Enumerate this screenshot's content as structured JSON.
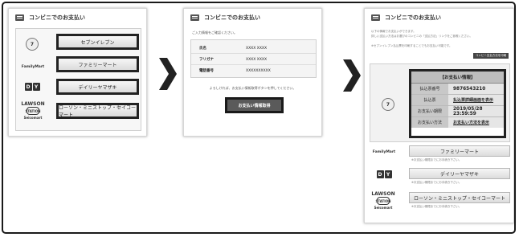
{
  "panel1": {
    "title": "コンビニでのお支払い",
    "stores": [
      {
        "logo": "7",
        "label": "セブンイレブン"
      },
      {
        "logo": "FamilyMart",
        "label": "ファミリーマート"
      },
      {
        "logo": "DY",
        "label": "デイリーヤマザキ"
      },
      {
        "logo": "LAWSON",
        "label": "ローソン・ミニストップ・セイコーマート"
      }
    ]
  },
  "panel2": {
    "title": "コンビニでのお支払い",
    "intro": "ご入力情報をご確認ください。",
    "rows": [
      {
        "key": "氏名",
        "value": "XXXX XXXX"
      },
      {
        "key": "フリガナ",
        "value": "XXXX XXXX"
      },
      {
        "key": "電話番号",
        "value": "XXXXXXXXXX"
      }
    ],
    "note": "よろしければ、お支払い情報取得ボタンを押してください。",
    "submit_label": "お支払い情報取得"
  },
  "panel3": {
    "title": "コンビニでのお支払い",
    "intro_line1": "以下の情報でお支払いができます。",
    "intro_line2": "詳しい支払い方法はお選びのコンビニの「支払方法」リンクをご参照ください。",
    "intro_line3": "※セブンイレブン払込票を印刷することでもお支払い可能です。",
    "print_label": "コンビニ支払方法を印刷",
    "info_title": "【お支払い情報】",
    "info_rows": [
      {
        "key": "払込票番号",
        "value": "9876543210"
      },
      {
        "key": "払込票",
        "value": "払込票詳細画面を表示"
      },
      {
        "key": "お支払い期限",
        "value": "2019/05/28 23:59:59"
      },
      {
        "key": "お支払い方法",
        "value": "お支払い方法を表示"
      }
    ],
    "stores": [
      {
        "logo": "FamilyMart",
        "label": "ファミリーマート",
        "note": "※お支払い期限までにお手続き下さい。"
      },
      {
        "logo": "DY",
        "label": "デイリーヤマザキ",
        "note": "※お支払い期限までにお手続き下さい。"
      },
      {
        "logo": "LAWSON",
        "label": "ローソン・ミニストップ・セイコーマート",
        "note": "※お支払い期限までにお手続き下さい。"
      }
    ]
  },
  "logos": {
    "seven": "7",
    "familymart": "FamilyMart",
    "dy1": "D",
    "dy2": "Y",
    "lawson": "LAWSON",
    "lawson_mark": "STATION",
    "seicomart": "Seicomart"
  }
}
